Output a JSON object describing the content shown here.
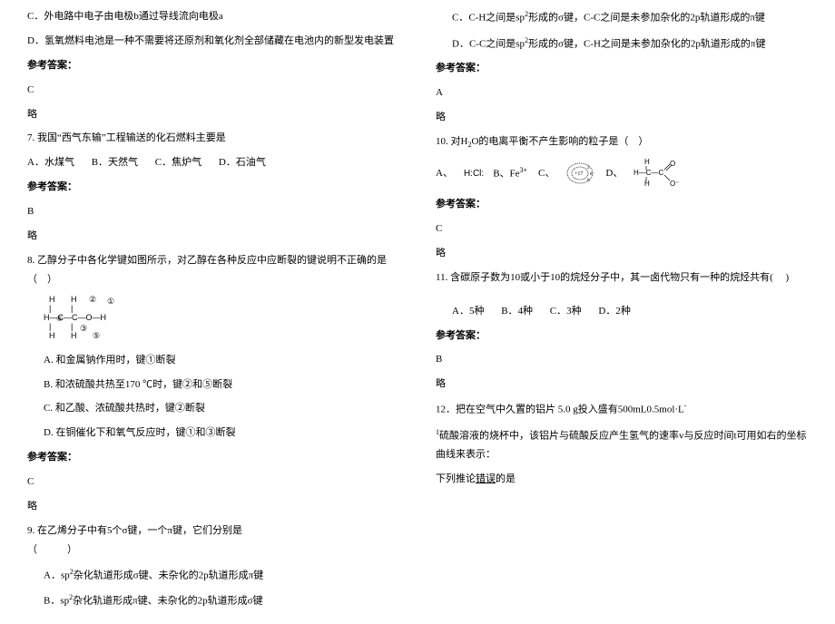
{
  "left": {
    "opt_c": "C．外电路中电子由电极b通过导线流向电极a",
    "opt_d": "D．氢氧燃料电池是一种不需要将还原剂和氧化剂全部储藏在电池内的新型发电装置",
    "ref_label": "参考答案：",
    "ans6": "C",
    "lue": "略",
    "q7": "7. 我国“西气东输”工程输送的化石燃料主要是",
    "q7a": "A．水煤气",
    "q7b": "B．天然气",
    "q7c": "C．焦炉气",
    "q7d": "D．石油气",
    "ans7": "B",
    "q8": "8. 乙醇分子中各化学键如图所示，对乙醇在各种反应中应断裂的键说明不正确的是（　）",
    "q8a": "A. 和金属钠作用时，键①断裂",
    "q8b": "B. 和浓硫酸共热至170 ℃时，键②和⑤断裂",
    "q8c": "C. 和乙酸、浓硫酸共热时，键②断裂",
    "q8d": "D. 在铜催化下和氧气反应时，键①和③断裂",
    "ans8": "C",
    "q9": "9. 在乙烯分子中有5个σ键，一个π键，它们分别是",
    "q9paren": "（　　　）",
    "q9a": "A．sp2杂化轨道形成σ键、未杂化的2p轨道形成π键",
    "q9b": "B．sp2杂化轨道形成π键、未杂化的2p轨道形成σ键"
  },
  "right": {
    "q9c": "C．C-H之间是sp2形成的σ键，C-C之间是未参加杂化的2p轨道形成的π键",
    "q9d": "D．C-C之间是sp2形成的σ键，C-H之间是未参加杂化的2p轨道形成的π键",
    "ref_label": "参考答案：",
    "ans9": "A",
    "lue": "略",
    "q10": "10. 对H2O的电离平衡不产生影响的粒子是（　）",
    "q10a": "A、",
    "q10b": "B、Fe3+",
    "q10c": "C、",
    "q10d": "D、",
    "ans10": "C",
    "q11": "11. 含碳原子数为10或小于10的烷烃分子中，其一卤代物只有一种的烷烃共有(　 )",
    "q11a": "A．5种",
    "q11b": "B．4种",
    "q11c": "C．3种",
    "q11d": "D．2种",
    "ans11": "B",
    "q12a": "12．把在空气中久置的铝片 5.0 g投入盛有500mL0.5mol·L-",
    "q12b": "1硫酸溶液的烧杯中，该铝片与硫酸反应产生氢气的速率v与反应时间t可用如右的坐标曲线来表示：",
    "q12c": "下列推论错误的是"
  }
}
